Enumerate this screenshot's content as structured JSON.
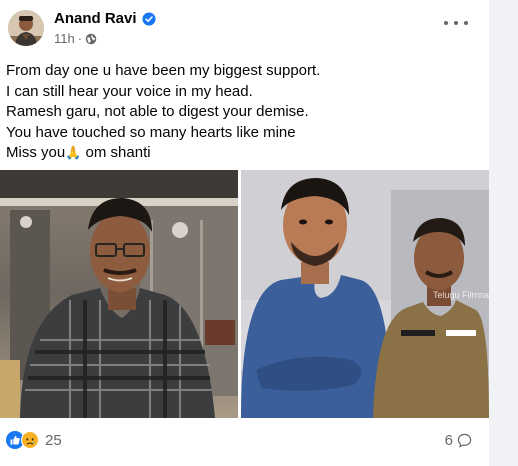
{
  "post": {
    "author": "Anand Ravi",
    "time": "11h",
    "dot": "·",
    "lines": [
      "From day one u have been my biggest support.",
      "I can still hear your voice in my head.",
      "Ramesh garu, not able to digest your demise.",
      "You have touched so many hearts like mine"
    ],
    "last_line_start": "Miss you",
    "last_line_emoji": "🙏",
    "last_line_end": " om shanti",
    "watermark": "Telugu Filmnagar"
  },
  "footer": {
    "reaction_count": "25",
    "comment_count": "6"
  },
  "colors": {
    "verified": "#1877f2",
    "like": "#1877f2",
    "sad": "#f7b125",
    "secondary_text": "#65676b"
  },
  "icons": [
    "verified-badge-icon",
    "globe-icon",
    "more-options-icon",
    "like-reaction-icon",
    "sad-reaction-icon",
    "comment-icon"
  ]
}
